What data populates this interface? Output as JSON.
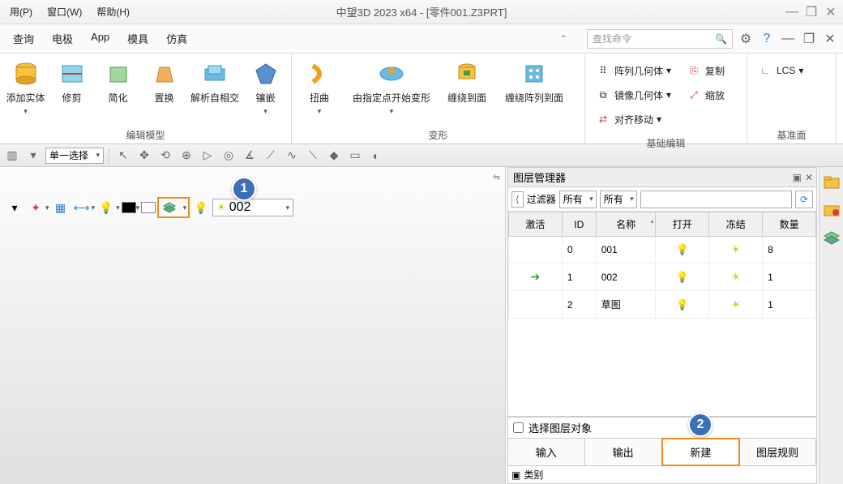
{
  "title": "中望3D 2023 x64 - [零件001.Z3PRT]",
  "menus": [
    "用(P)",
    "窗口(W)",
    "帮助(H)"
  ],
  "tabs": [
    "查询",
    "电极",
    "App",
    "模具",
    "仿真"
  ],
  "search_placeholder": "查找命令",
  "ribbon": {
    "g1": {
      "label": "编辑模型",
      "btns": [
        "添加实体",
        "修剪",
        "简化",
        "置换",
        "解析自相交",
        "镶嵌"
      ]
    },
    "g2": {
      "label": "变形",
      "btns": [
        "扭曲",
        "由指定点开始变形",
        "缠绕到面",
        "缠绕阵列到面"
      ]
    },
    "g3": {
      "label": "基础编辑",
      "items": [
        "阵列几何体",
        "镜像几何体",
        "对齐移动",
        "复制",
        "缩放"
      ]
    },
    "g4": {
      "label": "基准面",
      "item": "LCS"
    }
  },
  "selmode": "单一选择",
  "layerbar": {
    "current": "002"
  },
  "panel": {
    "title": "图层管理器",
    "filter_label": "过滤器",
    "filter_v1": "所有",
    "filter_v2": "所有",
    "cols": [
      "激活",
      "ID",
      "名称",
      "打开",
      "冻结",
      "数量"
    ],
    "rows": [
      {
        "active": "",
        "id": "0",
        "name": "001",
        "qty": "8"
      },
      {
        "active": "→",
        "id": "1",
        "name": "002",
        "qty": "1"
      },
      {
        "active": "",
        "id": "2",
        "name": "草图",
        "qty": "1"
      }
    ],
    "checkbox": "选择图层对象",
    "btns": [
      "输入",
      "输出",
      "新建",
      "图层规则"
    ],
    "cat": "类别"
  },
  "callouts": {
    "c1": "1",
    "c2": "2"
  }
}
